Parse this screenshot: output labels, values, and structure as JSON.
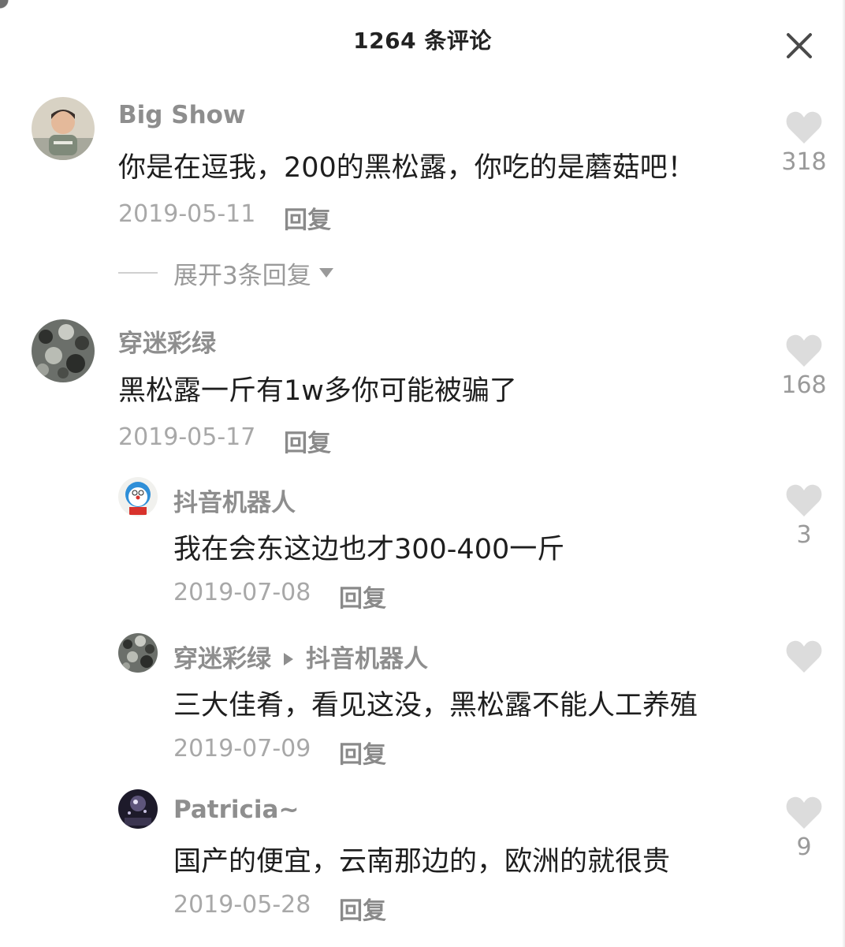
{
  "header": {
    "title": "1264 条评论"
  },
  "reply_label": "回复",
  "comments": [
    {
      "author": "Big  Show",
      "text": "你是在逗我，200的黑松露，你吃的是蘑菇吧！",
      "date": "2019-05-11",
      "likes": "318",
      "expand_label": "展开3条回复"
    },
    {
      "author": "穿迷彩绿",
      "text": "黑松露一斤有1w多你可能被骗了",
      "date": "2019-05-17",
      "likes": "168",
      "replies": [
        {
          "author": "抖音机器人",
          "text": "我在会东这边也才300-400一斤",
          "date": "2019-07-08",
          "likes": "3"
        },
        {
          "author": "穿迷彩绿",
          "reply_to": "抖音机器人",
          "text": "三大佳肴，看见这没，黑松露不能人工养殖",
          "date": "2019-07-09",
          "likes": ""
        },
        {
          "author": "Patricia~",
          "text": "国产的便宜，云南那边的，欧洲的就很贵",
          "date": "2019-05-28",
          "likes": "9"
        }
      ]
    }
  ],
  "colors": {
    "heart": "#dcdcdc",
    "muted_text": "#a8a8a8",
    "author_text": "#8e8e8e"
  },
  "icons": {
    "close": "close-icon",
    "like": "heart-icon",
    "expand": "chevron-down-icon",
    "reply_to": "play-arrow-icon"
  }
}
